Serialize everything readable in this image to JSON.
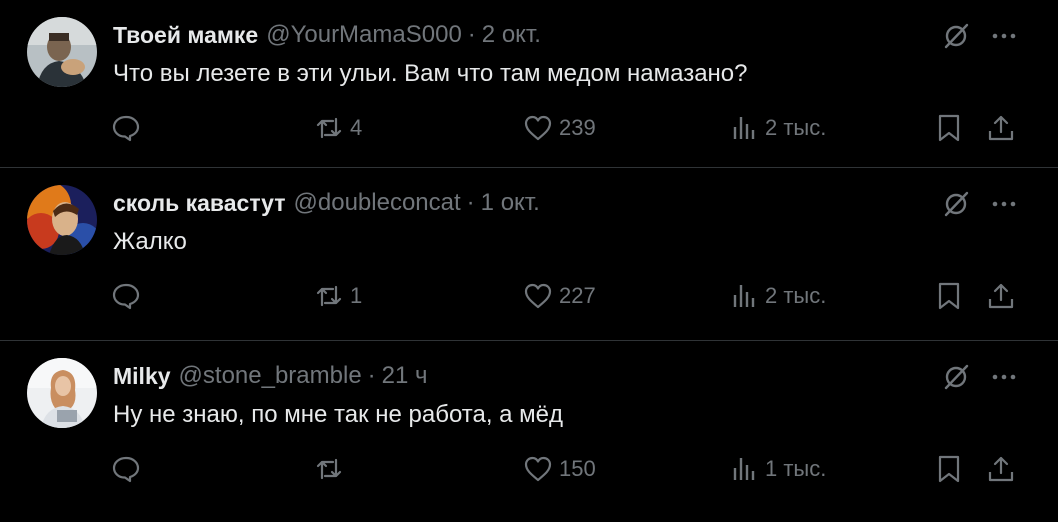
{
  "posts": [
    {
      "author": "Твоей мамке",
      "handle": "@YourMamaS000",
      "separator": "·",
      "time": "2 окт.",
      "text": "Что вы лезете в эти ульи. Вам что там медом намазано?",
      "replies": "",
      "reposts": "4",
      "likes": "239",
      "views": "2 тыс."
    },
    {
      "author": "сколь кавастут",
      "handle": "@doubleconcat",
      "separator": "·",
      "time": "1 окт.",
      "text": "Жалко",
      "replies": "",
      "reposts": "1",
      "likes": "227",
      "views": "2 тыс."
    },
    {
      "author": "Milky",
      "handle": "@stone_bramble",
      "separator": "·",
      "time": "21 ч",
      "text": "Ну не знаю, по мне так не работа, а мёд",
      "replies": "",
      "reposts": "",
      "likes": "150",
      "views": "1 тыс."
    }
  ],
  "icons": {
    "reply": "reply-icon",
    "repost": "repost-icon",
    "like": "heart-icon",
    "views": "analytics-icon",
    "bookmark": "bookmark-icon",
    "share": "share-icon",
    "grok": "grok-icon",
    "more": "more-icon"
  },
  "colors": {
    "background": "#000000",
    "text": "#e7e9ea",
    "secondary": "#71767b",
    "divider": "#2f3336"
  }
}
